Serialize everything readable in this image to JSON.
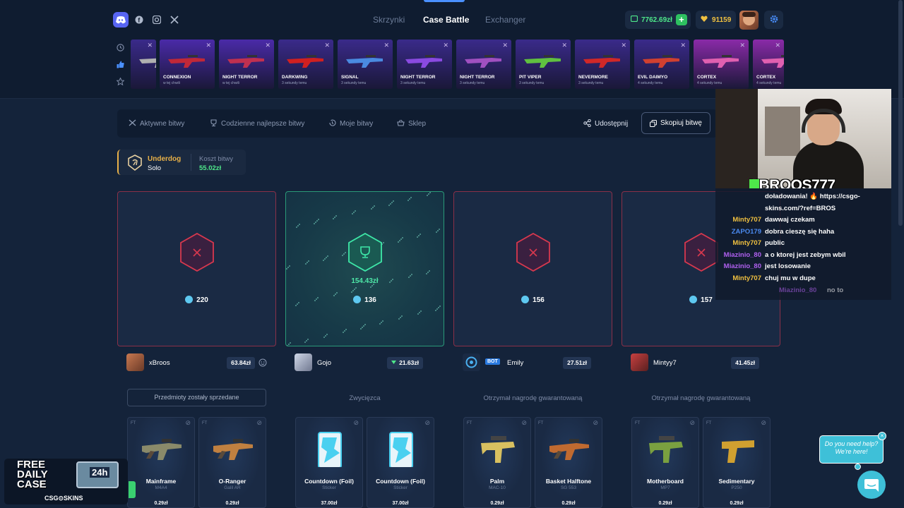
{
  "header": {
    "nav": [
      "Skrzynki",
      "Case Battle",
      "Exchanger"
    ],
    "balance": "7762.69zł",
    "coins": "91159"
  },
  "drops": [
    {
      "name": "",
      "sub": "",
      "color": "#3a2a8a"
    },
    {
      "name": "CONNEXION",
      "sub": "w tej chwili",
      "color": "#4a2aa8"
    },
    {
      "name": "NIGHT TERROR",
      "sub": "w tej chwili",
      "color": "#4a2aa8"
    },
    {
      "name": "DARKWING",
      "sub": "3 sekundy temu",
      "color": "#3a2a8a"
    },
    {
      "name": "SIGNAL",
      "sub": "3 sekundy temu",
      "color": "#3a2a8a"
    },
    {
      "name": "NIGHT TERROR",
      "sub": "3 sekundy temu",
      "color": "#3a2a8a"
    },
    {
      "name": "NIGHT TERROR",
      "sub": "3 sekundy temu",
      "color": "#3a2a8a"
    },
    {
      "name": "PIT VIPER",
      "sub": "3 sekundy temu",
      "color": "#3a2a8a"
    },
    {
      "name": "NEVERMORE",
      "sub": "3 sekundy temu",
      "color": "#3a2a8a"
    },
    {
      "name": "EVIL DAIMYO",
      "sub": "4 sekundy temu",
      "color": "#3a2a8a"
    },
    {
      "name": "CORTEX",
      "sub": "4 sekundy temu",
      "color": "#8a2aa8"
    },
    {
      "name": "CORTEX",
      "sub": "4 sekundy temu",
      "color": "#8a2aa8"
    }
  ],
  "tabs": {
    "active": "Aktywne bitwy",
    "daily": "Codzienne najlepsze bitwy",
    "mine": "Moje bitwy",
    "shop": "Sklep",
    "share": "Udostępnij",
    "copy": "Skopiuj bitwę"
  },
  "mode": {
    "name": "Underdog",
    "sub": "Solo",
    "cost_label": "Koszt bitwy",
    "cost": "55.02zł"
  },
  "arenas": [
    {
      "coins": "220",
      "state": "lose"
    },
    {
      "coins": "136",
      "state": "win",
      "win_amount": "154.43zł"
    },
    {
      "coins": "156",
      "state": "lose"
    },
    {
      "coins": "157",
      "state": "lose"
    }
  ],
  "players": [
    {
      "name": "xBroos",
      "value": "63.84zł",
      "status": "Przedmioty zostały sprzedane"
    },
    {
      "name": "Gojo",
      "value": "21.63zł",
      "status": "Zwycięzca"
    },
    {
      "name": "Emily",
      "bot": "BOT",
      "value": "27.51zł",
      "status": "Otrzymał nagrodę gwarantowaną"
    },
    {
      "name": "Mintyy7",
      "value": "41.45zł",
      "status": "Otrzymał nagrodę gwarantowaną"
    }
  ],
  "items": [
    {
      "q": "FT",
      "name": "Mainframe",
      "type": "M4A4",
      "price": "0.29zł",
      "kind": "rifle",
      "color": "#8a8a6a"
    },
    {
      "q": "FT",
      "name": "O-Ranger",
      "type": "Galil AR",
      "price": "0.29zł",
      "kind": "rifle",
      "color": "#c08040"
    },
    {
      "q": "",
      "name": "Countdown (Foil)",
      "type": "Sticker",
      "price": "37.00zł",
      "kind": "sticker",
      "color": "#4ad0f0"
    },
    {
      "q": "",
      "name": "Countdown (Foil)",
      "type": "Sticker",
      "price": "37.00zł",
      "kind": "sticker",
      "color": "#4ad0f0"
    },
    {
      "q": "FT",
      "name": "Palm",
      "type": "MAC-10",
      "price": "0.29zł",
      "kind": "smg",
      "color": "#d8c060"
    },
    {
      "q": "FT",
      "name": "Basket Halftone",
      "type": "SG 553",
      "price": "0.29zł",
      "kind": "rifle",
      "color": "#c06a30"
    },
    {
      "q": "FT",
      "name": "Motherboard",
      "type": "MP7",
      "price": "0.29zł",
      "kind": "smg",
      "color": "#7aa040"
    },
    {
      "q": "FT",
      "name": "Sedimentary",
      "type": "P250",
      "price": "0.29zł",
      "kind": "pistol",
      "color": "#d0a030"
    }
  ],
  "stream": {
    "overlay": "XBROOS777"
  },
  "chat": [
    {
      "user": "",
      "text": "doładowania! 🔥 https://csgo-",
      "color": "#fff"
    },
    {
      "user": "",
      "text": "skins.com/?ref=BROS",
      "color": "#fff"
    },
    {
      "user": "Minty707",
      "text": "dawwaj czekam",
      "color": "#f0c040"
    },
    {
      "user": "ZAPO179",
      "text": "dobra cieszę się haha",
      "color": "#4a8af0"
    },
    {
      "user": "Minty707",
      "text": "public",
      "color": "#f0c040"
    },
    {
      "user": "Miazinio_80",
      "text": "a o ktorej jest zebym wbil",
      "color": "#b060f0"
    },
    {
      "user": "Miazinio_80",
      "text": "jest losowanie",
      "color": "#b060f0"
    },
    {
      "user": "Minty707",
      "text": "chuj mu w dupe",
      "color": "#f0c040"
    },
    {
      "user": "Miazinio_80",
      "text": "no to",
      "color": "#b060f0"
    }
  ],
  "promo": {
    "line1": "FREE",
    "line2": "DAILY",
    "line3": "CASE",
    "brand": "CSG⊙SKINS",
    "box_label": "24h"
  },
  "help": {
    "line1": "Do you need help?",
    "line2": "We're here!"
  }
}
